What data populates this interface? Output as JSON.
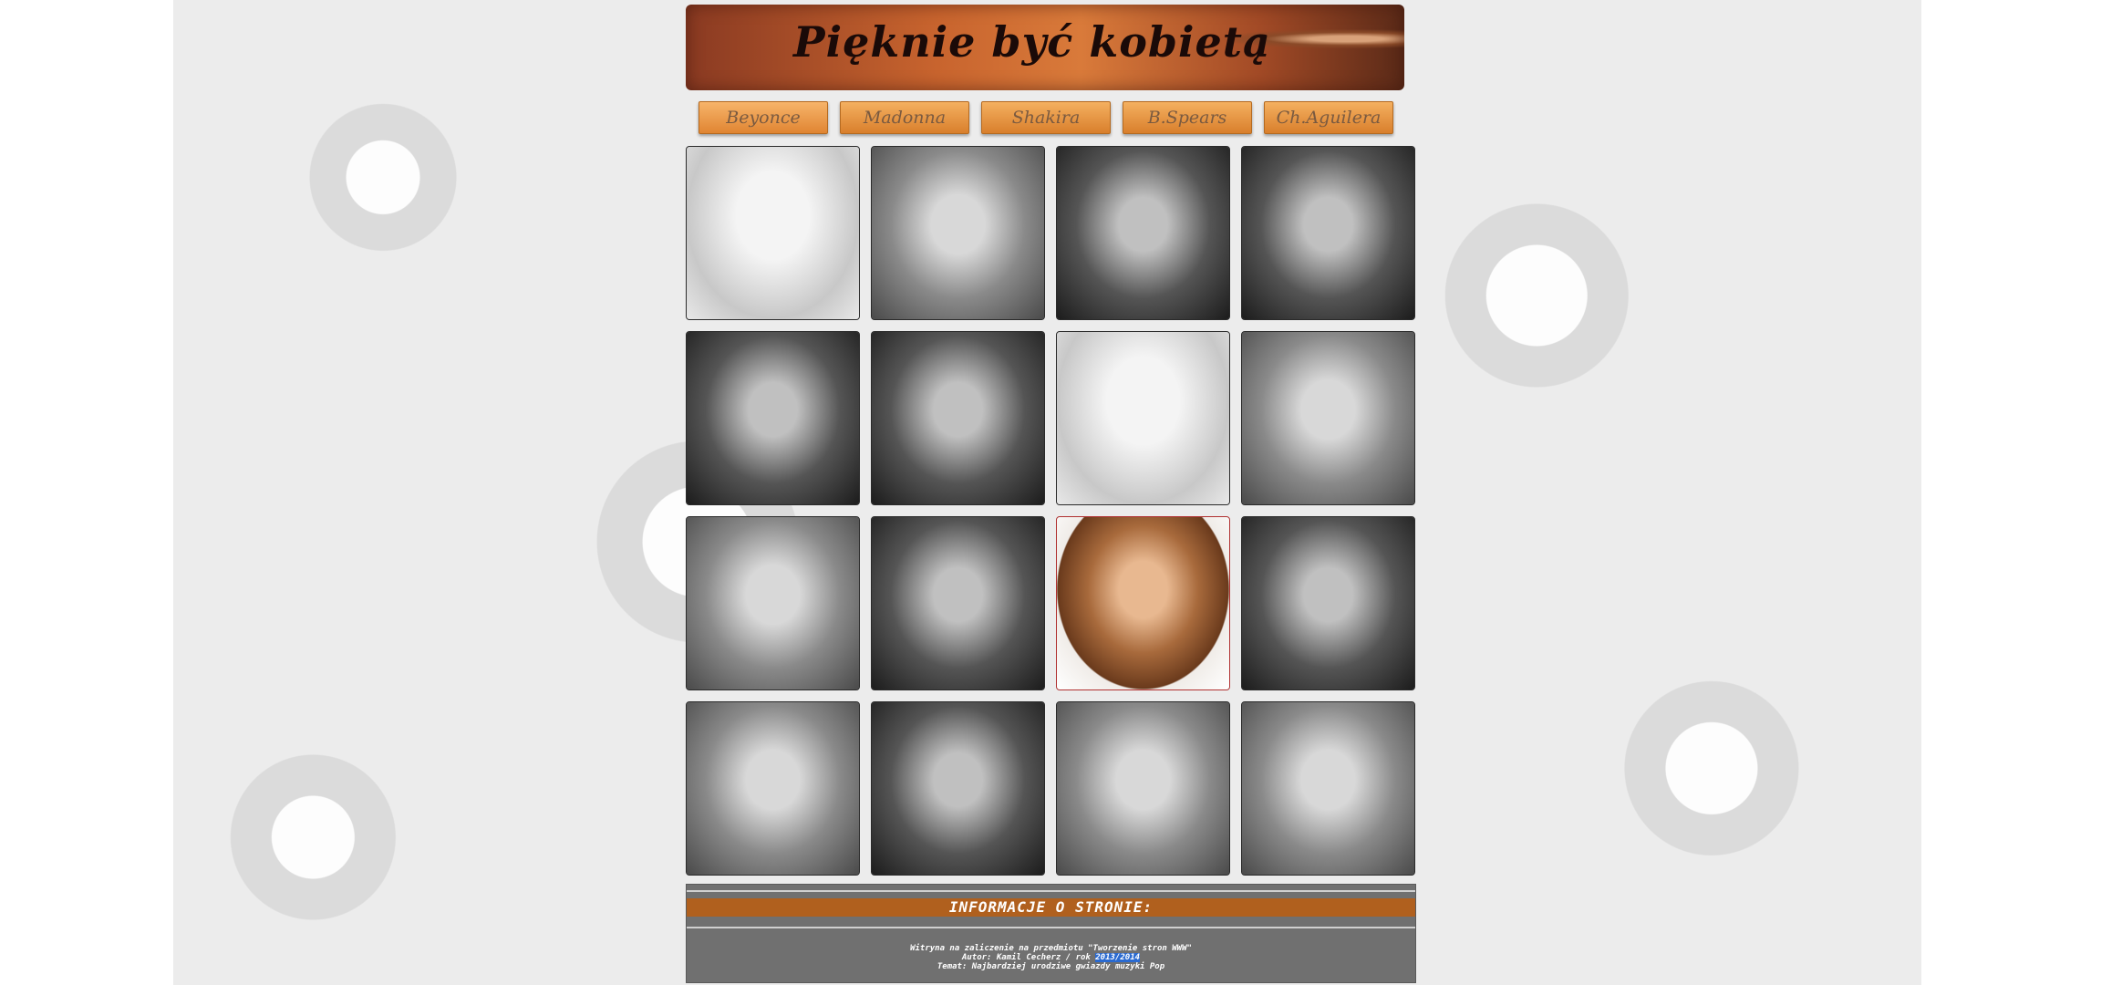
{
  "header": {
    "title": "Pięknie być kobietą"
  },
  "nav": [
    {
      "label": "Beyonce"
    },
    {
      "label": "Madonna"
    },
    {
      "label": "Shakira"
    },
    {
      "label": "B.Spears"
    },
    {
      "label": "Ch.Aguilera"
    }
  ],
  "gallery": {
    "artist": "Beyonce",
    "photos": [
      {
        "tone": "light",
        "color": false
      },
      {
        "tone": "mid",
        "color": false
      },
      {
        "tone": "dark",
        "color": false
      },
      {
        "tone": "dark",
        "color": false
      },
      {
        "tone": "dark",
        "color": false
      },
      {
        "tone": "dark",
        "color": false
      },
      {
        "tone": "light",
        "color": false
      },
      {
        "tone": "mid",
        "color": false
      },
      {
        "tone": "mid",
        "color": false
      },
      {
        "tone": "dark",
        "color": false
      },
      {
        "tone": "light",
        "color": true
      },
      {
        "tone": "dark",
        "color": false
      },
      {
        "tone": "mid",
        "color": false
      },
      {
        "tone": "dark",
        "color": false
      },
      {
        "tone": "mid",
        "color": false
      },
      {
        "tone": "mid",
        "color": false
      }
    ]
  },
  "info": {
    "heading": "INFORMACJE O STRONIE:",
    "line1": "Witryna na zaliczenie na przedmiotu \"Tworzenie stron WWW\"",
    "line2_prefix": "Autor: Kamil Cecherz / rok ",
    "line2_year": "2013/2014",
    "line3": "Temat: Najbardziej urodziwe gwiazdy muzyki Pop"
  },
  "colors": {
    "accent": "#b0601e",
    "nav_button": "#e08532",
    "info_bg": "#707070"
  }
}
